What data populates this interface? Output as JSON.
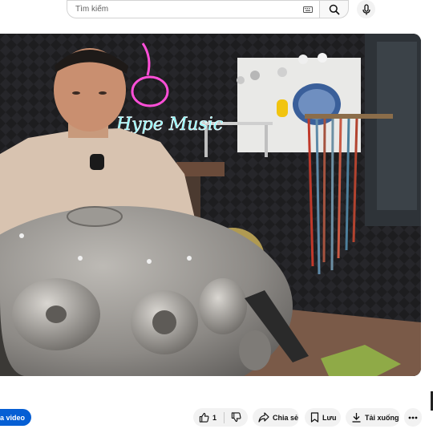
{
  "search": {
    "placeholder": "Tìm kiếm"
  },
  "player": {
    "neon_sign": "Hype Music"
  },
  "actions": {
    "edit_video": "ửa video",
    "like_count": "1",
    "share": "Chia sẻ",
    "save": "Lưu",
    "download": "Tải xuống"
  },
  "colors": {
    "accent": "#065fd4",
    "pill_bg": "#f2f2f2"
  }
}
